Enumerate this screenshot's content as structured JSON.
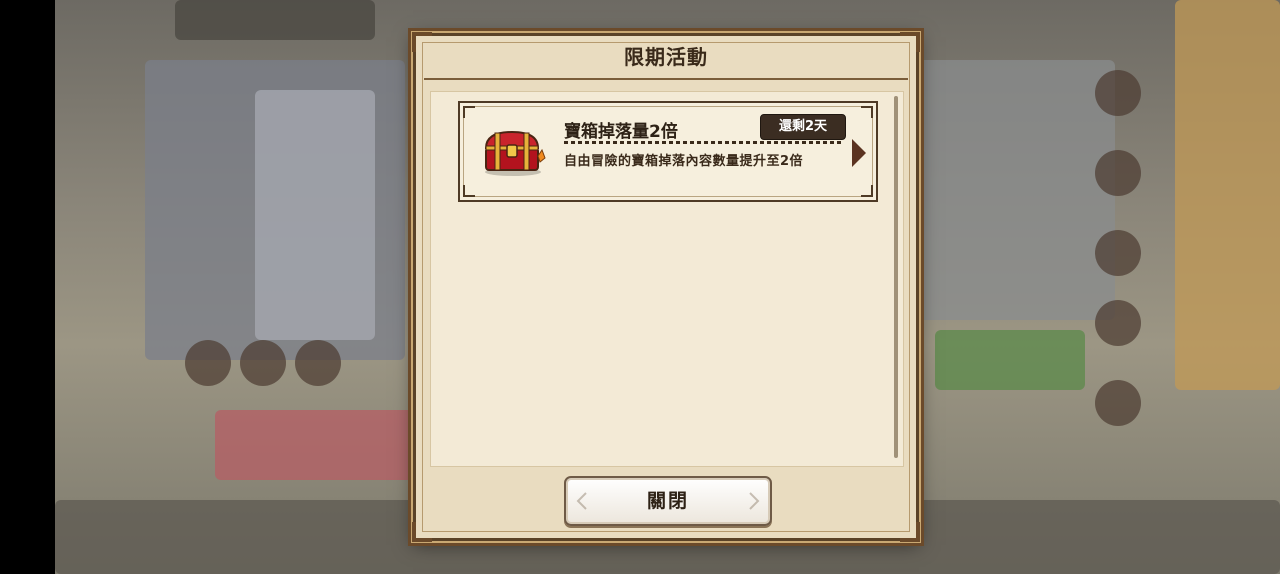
{
  "dialog": {
    "title": "限期活動",
    "close_label": "關閉"
  },
  "events": [
    {
      "title": "寶箱掉落量2倍",
      "time_left": "還剩2天",
      "description": "自由冒險的寶箱掉落內容數量提升至2倍",
      "icon": "treasure-chest-icon"
    }
  ],
  "colors": {
    "dialog_bg": "#e9dcc0",
    "frame": "#5a4227",
    "badge_bg": "#3b2d22"
  }
}
